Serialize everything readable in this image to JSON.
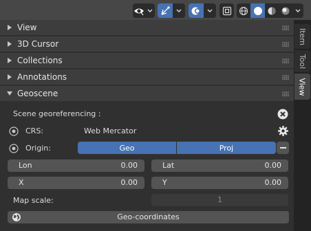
{
  "header": {
    "icons": [
      "eye-icon",
      "chevron-down-icon",
      "gizmo-icon",
      "chevron-down-icon",
      "overlay-icon",
      "chevron-down-icon",
      "xray-icon",
      "wireframe-icon",
      "solid-icon",
      "material-icon",
      "rendered-icon",
      "chevron-down-icon"
    ]
  },
  "panels": [
    {
      "label": "View",
      "expanded": false
    },
    {
      "label": "3D Cursor",
      "expanded": false
    },
    {
      "label": "Collections",
      "expanded": false
    },
    {
      "label": "Annotations",
      "expanded": false
    },
    {
      "label": "Geoscene",
      "expanded": true
    }
  ],
  "geoscene": {
    "title": "Scene georeferencing :",
    "crs_label": "CRS:",
    "crs_value": "Web Mercator",
    "origin_label": "Origin:",
    "origin_buttons": [
      "Geo",
      "Proj"
    ],
    "lon_label": "Lon",
    "lon_value": "0.00",
    "lat_label": "Lat",
    "lat_value": "0.00",
    "x_label": "X",
    "x_value": "0.00",
    "y_label": "Y",
    "y_value": "0.00",
    "map_scale_label": "Map scale:",
    "map_scale_value": "1",
    "geocoords_button": "Geo-coordinates"
  },
  "tabs": [
    {
      "label": "Item",
      "active": false
    },
    {
      "label": "Tool",
      "active": false
    },
    {
      "label": "View",
      "active": true
    }
  ],
  "colors": {
    "accent": "#4772b3",
    "panel_bg": "#303030",
    "header_bg": "#3d3d3d",
    "field_bg": "#545454"
  }
}
